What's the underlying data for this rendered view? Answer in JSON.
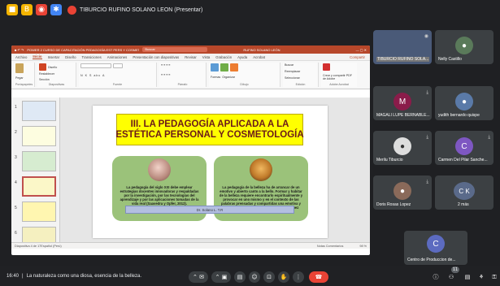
{
  "topbar": {
    "meeting_title": "TIBURCIO RUFINO SOLANO LEON (Presentar)"
  },
  "ppt": {
    "title": "POWER 2 CURSO DE CAPACITACIÓN PEDAGOGÍA EST PERS Y COSMETOLOGÍA - PowerPoint",
    "search_placeholder": "Buscar",
    "user": "RUFINO SOLANO LEÓN",
    "share_label": "Compartir",
    "tabs": [
      "Archivo",
      "Inicio",
      "Insertar",
      "Diseño",
      "Transiciones",
      "Animaciones",
      "Presentación con diapositivas",
      "Revisar",
      "Vista",
      "Grabación",
      "Ayuda",
      "Acrobat"
    ],
    "ribbon_groups": [
      "Portapapeles",
      "Diapositivas",
      "Fuente",
      "Párrafo",
      "Dibujo",
      "Edición",
      "Adobe Acrobat"
    ],
    "ribbon_items": [
      "Pegar",
      "Nueva diapositiva",
      "Diseño",
      "Restablecer",
      "Sección",
      "Formas",
      "Organizar",
      "Estilos rápidos",
      "Buscar",
      "Reemplazar",
      "Seleccionar",
      "Crear y compartir PDF de Adobe"
    ],
    "slide_numbers": [
      "1",
      "2",
      "3",
      "4",
      "5",
      "6"
    ],
    "status_left": "Diapositiva 4 de 17",
    "status_lang": "Español (Perú)",
    "status_right": "Notas  Comentarios",
    "zoom": "98 %"
  },
  "slide": {
    "title_line1": "III. LA PEDAGOGÍA APLICADA A LA",
    "title_line2": "ESTÉTICA PERSONAL Y COSMETOLOGÍA",
    "card_left_text": "La pedagogía del siglo XXI debe emplear estrategias docentes innovadoras y respaldadas por la investigación, por las tecnologías del aprendizaje y por las aplicaciones tomadas de la vida real (Saavedra y Opfer, 2012).",
    "card_right_text": "La pedagogía de la belleza ha de arrancar de un emotivo y abierto canto a la bello. Formar y habitar de la belleza requiere encontrarlo espiritualmente y provocar en uno mismo y en el contexto de las palabras prensadas y compartidas una emotiva y racionalizada vibración espiritual. (Jose López Arquiza Homenaje 2012)",
    "arrow_text": "Dr. Solano L. T.R"
  },
  "participants": [
    {
      "name": "TIBURCIO RUFINO SOLA...",
      "initial": "",
      "color": "#4a5a78"
    },
    {
      "name": "Nelly Castillo",
      "initial": "",
      "color": "#5a7a5a"
    },
    {
      "name": "MAGALI LUPE BERNABLE...",
      "initial": "M",
      "color": "#8a1c4a"
    },
    {
      "name": "yudith bernardo quispe",
      "initial": "",
      "color": "#5a7aa8"
    },
    {
      "name": "Merilu Tiburcio",
      "initial": "",
      "color": "#6a6a6a"
    },
    {
      "name": "Carmen Del Pilar Sanche...",
      "initial": "C",
      "color": "#7e57c2"
    },
    {
      "name": "Doris Rosas Lopez",
      "initial": "",
      "color": "#8a6a5a"
    },
    {
      "name": "2 más",
      "initial": "C K",
      "color": "#5a6a8a"
    },
    {
      "name": "Centro de Produccion de...",
      "initial": "C",
      "color": "#5c6bc0"
    }
  ],
  "bottom": {
    "time": "16:40",
    "meeting_name": "La naturaleza como una diosa, esencia de la belleza.",
    "participant_count": "11"
  }
}
